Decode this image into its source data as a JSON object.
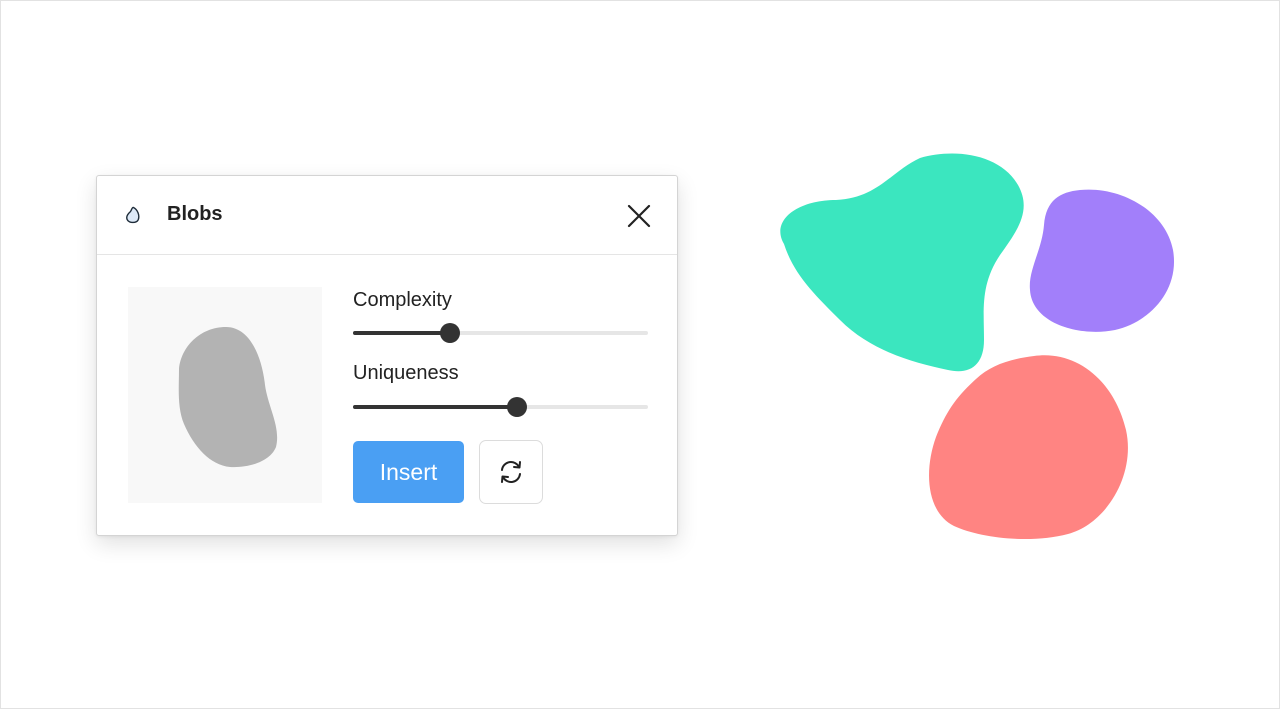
{
  "panel": {
    "title": "Blobs",
    "icon": "blob-icon",
    "close_icon": "close-icon"
  },
  "controls": {
    "complexity": {
      "label": "Complexity",
      "value": 0.33
    },
    "uniqueness": {
      "label": "Uniqueness",
      "value": 0.555
    }
  },
  "buttons": {
    "insert_label": "Insert",
    "refresh_icon": "refresh-icon"
  },
  "colors": {
    "insert_button": "#4a9ff3",
    "preview_blob": "#b3b3b3",
    "blob_green": "#3be6bf",
    "blob_purple": "#a27ffa",
    "blob_red": "#ff8482"
  }
}
